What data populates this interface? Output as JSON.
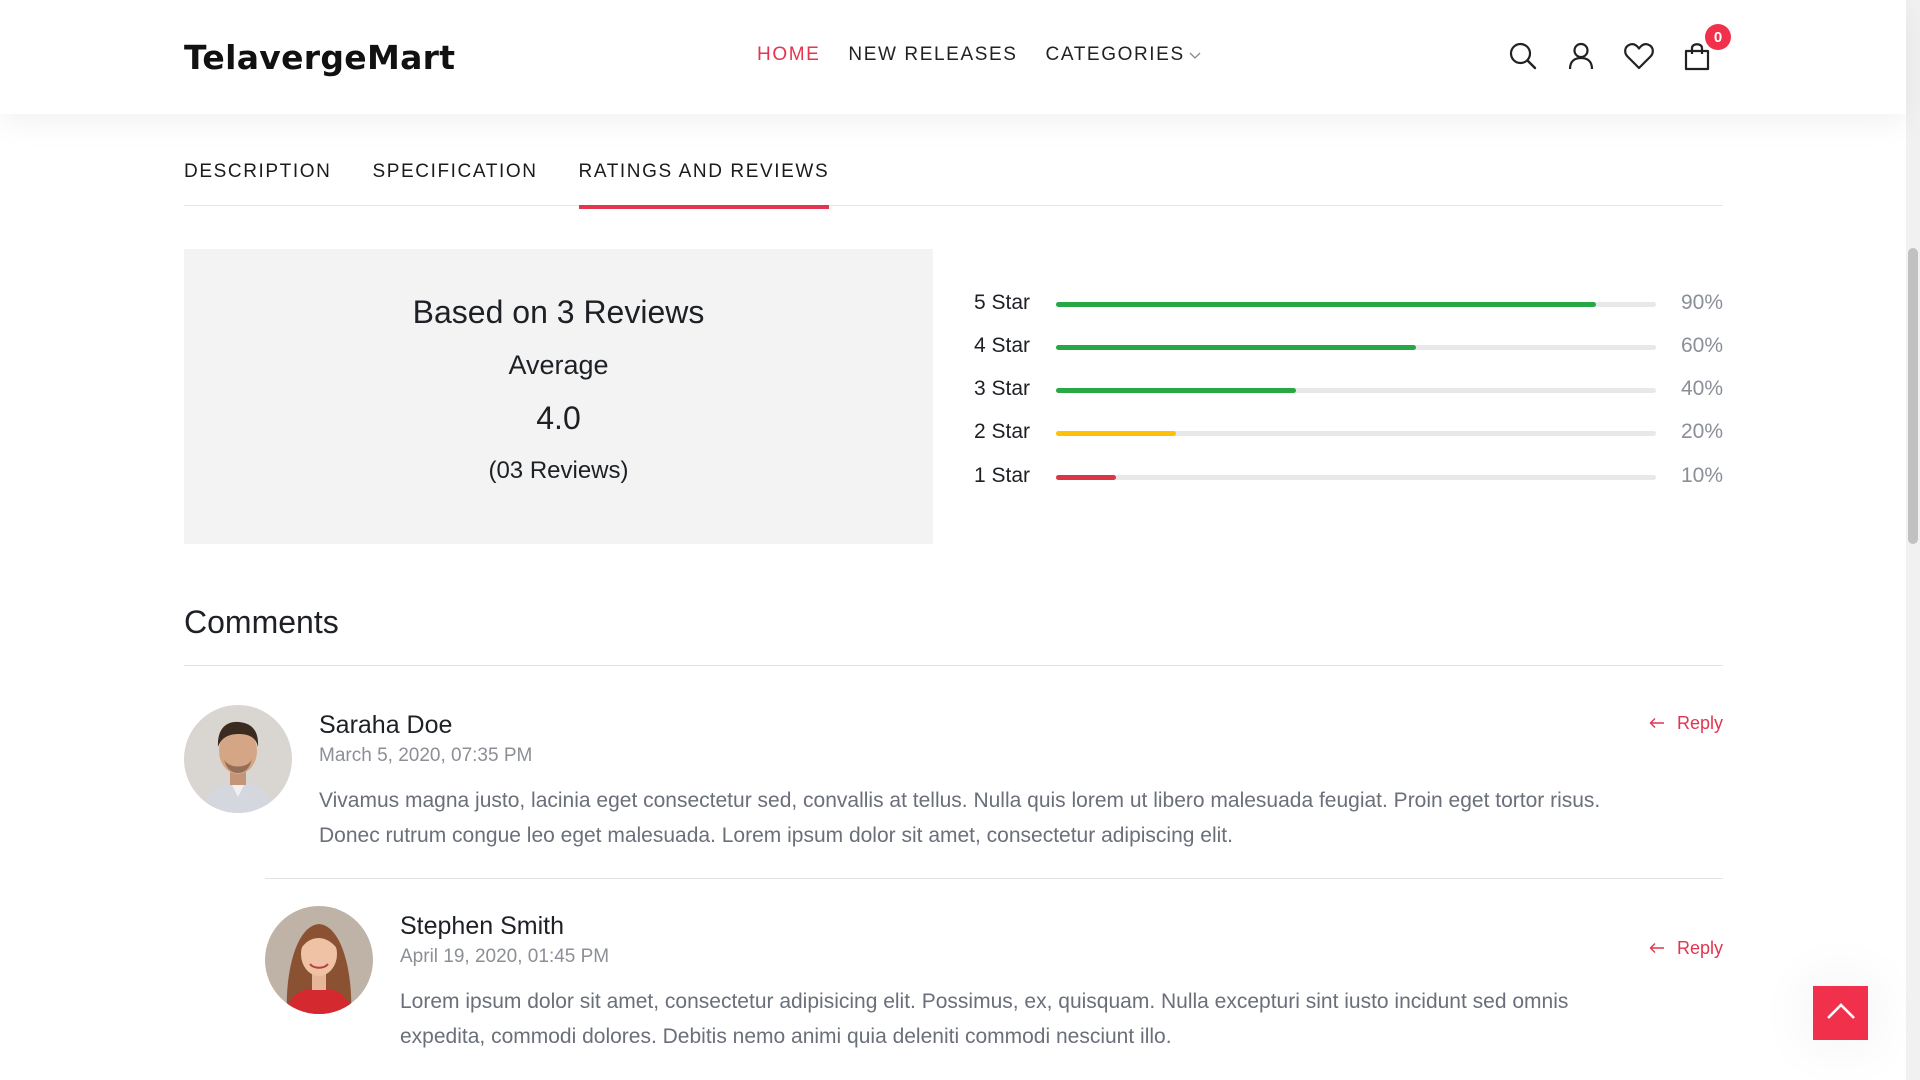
{
  "header": {
    "logo": "TelavergeMart",
    "nav": [
      {
        "label": "HOME",
        "active": true
      },
      {
        "label": "NEW RELEASES",
        "active": false
      },
      {
        "label": "CATEGORIES",
        "active": false
      }
    ],
    "cart_count": "0",
    "icons": [
      "search-icon",
      "user-icon",
      "heart-icon",
      "shopping-bag-icon"
    ]
  },
  "tabs": [
    {
      "label": "DESCRIPTION",
      "active": false
    },
    {
      "label": "SPECIFICATION",
      "active": false
    },
    {
      "label": "RATINGS AND REVIEWS",
      "active": true
    }
  ],
  "summary": {
    "title": "Based on 3 Reviews",
    "average_label": "Average",
    "average": "4.0",
    "count": "(03 Reviews)"
  },
  "ratings": [
    {
      "label": "5 Star",
      "percent": 90,
      "percent_text": "90%",
      "color": "#28a745"
    },
    {
      "label": "4 Star",
      "percent": 60,
      "percent_text": "60%",
      "color": "#28a745"
    },
    {
      "label": "3 Star",
      "percent": 40,
      "percent_text": "40%",
      "color": "#28a745"
    },
    {
      "label": "2 Star",
      "percent": 20,
      "percent_text": "20%",
      "color": "#ffc107"
    },
    {
      "label": "1 Star",
      "percent": 10,
      "percent_text": "10%",
      "color": "#dc3545"
    }
  ],
  "comments": {
    "title": "Comments",
    "items": [
      {
        "name": "Saraha Doe",
        "date": "March 5, 2020, 07:35 PM",
        "text_line1": "Vivamus magna justo, lacinia eget consectetur sed, convallis at tellus. Nulla quis lorem ut libero malesuada feugiat. Proin eget tortor risus.",
        "text_line2": "Donec rutrum congue leo eget malesuada. Lorem ipsum dolor sit amet, consectetur adipiscing elit.",
        "reply": "Reply"
      },
      {
        "name": "Stephen Smith",
        "date": "April 19, 2020, 01:45 PM",
        "text_line1": "Lorem ipsum dolor sit amet, consectetur adipisicing elit. Possimus, ex, quisquam. Nulla excepturi sint iusto incidunt sed omnis",
        "text_line2": "expedita, commodi dolores. Debitis nemo animi quia deleniti commodi nesciunt illo.",
        "reply": "Reply"
      }
    ]
  },
  "colors": {
    "accent": "#e4344f",
    "badge": "#f1304b"
  }
}
